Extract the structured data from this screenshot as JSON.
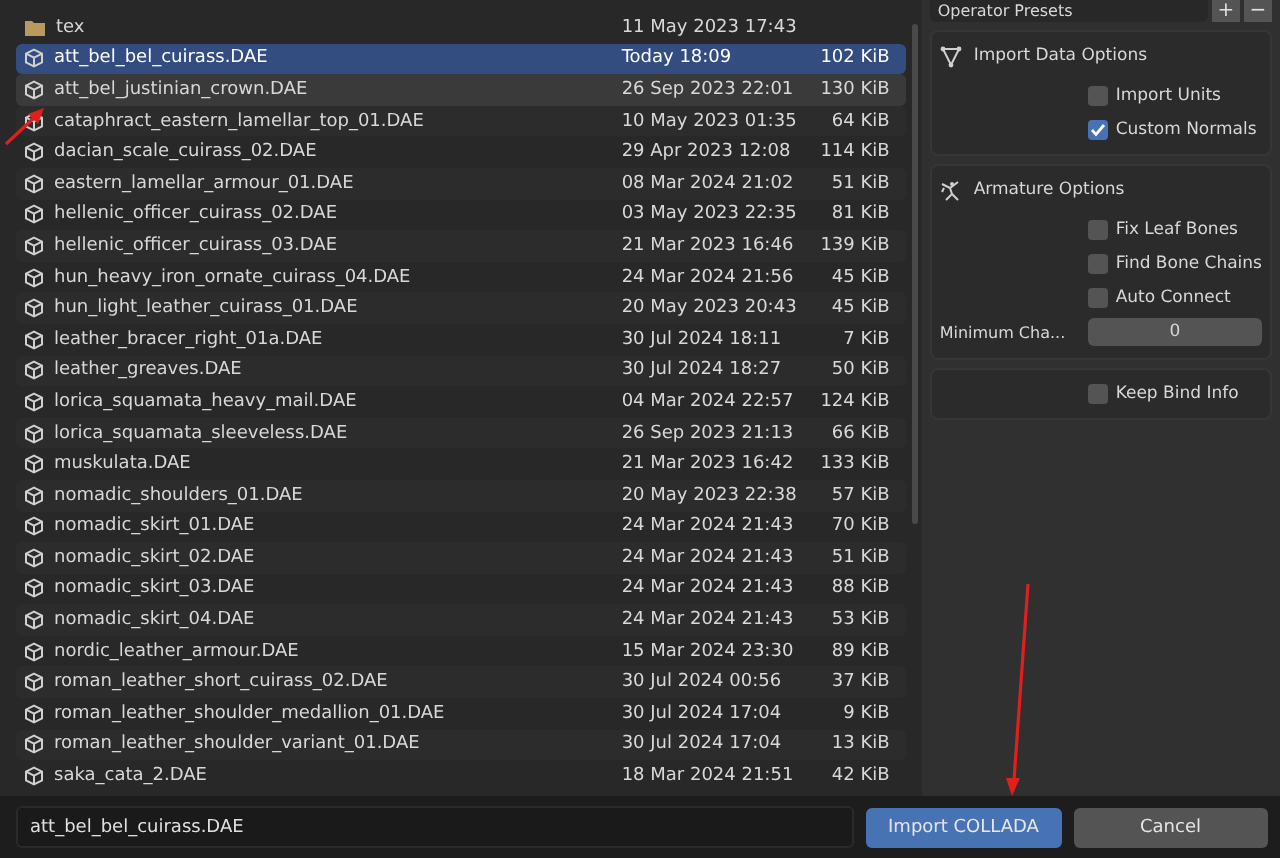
{
  "files": [
    {
      "kind": "folder",
      "name": "tex",
      "date": "11 May 2023 17:43",
      "selected": false,
      "highlighted": false
    },
    {
      "kind": "file",
      "name": "att_bel_bel_cuirass.DAE",
      "date": "Today 18:09",
      "size": "102 KiB",
      "selected": true,
      "highlighted": false
    },
    {
      "kind": "file",
      "name": "att_bel_justinian_crown.DAE",
      "date": "26 Sep 2023 22:01",
      "size": "130 KiB",
      "selected": false,
      "highlighted": true
    },
    {
      "kind": "file",
      "name": "cataphract_eastern_lamellar_top_01.DAE",
      "date": "10 May 2023 01:35",
      "size": "64 KiB",
      "selected": false,
      "highlighted": false
    },
    {
      "kind": "file",
      "name": "dacian_scale_cuirass_02.DAE",
      "date": "29 Apr 2023 12:08",
      "size": "114 KiB",
      "selected": false,
      "highlighted": false
    },
    {
      "kind": "file",
      "name": "eastern_lamellar_armour_01.DAE",
      "date": "08 Mar 2024 21:02",
      "size": "51 KiB",
      "selected": false,
      "highlighted": false
    },
    {
      "kind": "file",
      "name": "hellenic_officer_cuirass_02.DAE",
      "date": "03 May 2023 22:35",
      "size": "81 KiB",
      "selected": false,
      "highlighted": false
    },
    {
      "kind": "file",
      "name": "hellenic_officer_cuirass_03.DAE",
      "date": "21 Mar 2023 16:46",
      "size": "139 KiB",
      "selected": false,
      "highlighted": false
    },
    {
      "kind": "file",
      "name": "hun_heavy_iron_ornate_cuirass_04.DAE",
      "date": "24 Mar 2024 21:56",
      "size": "45 KiB",
      "selected": false,
      "highlighted": false
    },
    {
      "kind": "file",
      "name": "hun_light_leather_cuirass_01.DAE",
      "date": "20 May 2023 20:43",
      "size": "45 KiB",
      "selected": false,
      "highlighted": false
    },
    {
      "kind": "file",
      "name": "leather_bracer_right_01a.DAE",
      "date": "30 Jul 2024 18:11",
      "size": "7 KiB",
      "selected": false,
      "highlighted": false
    },
    {
      "kind": "file",
      "name": "leather_greaves.DAE",
      "date": "30 Jul 2024 18:27",
      "size": "50 KiB",
      "selected": false,
      "highlighted": false
    },
    {
      "kind": "file",
      "name": "lorica_squamata_heavy_mail.DAE",
      "date": "04 Mar 2024 22:57",
      "size": "124 KiB",
      "selected": false,
      "highlighted": false
    },
    {
      "kind": "file",
      "name": "lorica_squamata_sleeveless.DAE",
      "date": "26 Sep 2023 21:13",
      "size": "66 KiB",
      "selected": false,
      "highlighted": false
    },
    {
      "kind": "file",
      "name": "muskulata.DAE",
      "date": "21 Mar 2023 16:42",
      "size": "133 KiB",
      "selected": false,
      "highlighted": false
    },
    {
      "kind": "file",
      "name": "nomadic_shoulders_01.DAE",
      "date": "20 May 2023 22:38",
      "size": "57 KiB",
      "selected": false,
      "highlighted": false
    },
    {
      "kind": "file",
      "name": "nomadic_skirt_01.DAE",
      "date": "24 Mar 2024 21:43",
      "size": "70 KiB",
      "selected": false,
      "highlighted": false
    },
    {
      "kind": "file",
      "name": "nomadic_skirt_02.DAE",
      "date": "24 Mar 2024 21:43",
      "size": "51 KiB",
      "selected": false,
      "highlighted": false
    },
    {
      "kind": "file",
      "name": "nomadic_skirt_03.DAE",
      "date": "24 Mar 2024 21:43",
      "size": "88 KiB",
      "selected": false,
      "highlighted": false
    },
    {
      "kind": "file",
      "name": "nomadic_skirt_04.DAE",
      "date": "24 Mar 2024 21:43",
      "size": "53 KiB",
      "selected": false,
      "highlighted": false
    },
    {
      "kind": "file",
      "name": "nordic_leather_armour.DAE",
      "date": "15 Mar 2024 23:30",
      "size": "89 KiB",
      "selected": false,
      "highlighted": false
    },
    {
      "kind": "file",
      "name": "roman_leather_short_cuirass_02.DAE",
      "date": "30 Jul 2024 00:56",
      "size": "37 KiB",
      "selected": false,
      "highlighted": false
    },
    {
      "kind": "file",
      "name": "roman_leather_shoulder_medallion_01.DAE",
      "date": "30 Jul 2024 17:04",
      "size": "9 KiB",
      "selected": false,
      "highlighted": false
    },
    {
      "kind": "file",
      "name": "roman_leather_shoulder_variant_01.DAE",
      "date": "30 Jul 2024 17:04",
      "size": "13 KiB",
      "selected": false,
      "highlighted": false
    },
    {
      "kind": "file",
      "name": "saka_cata_2.DAE",
      "date": "18 Mar 2024 21:51",
      "size": "42 KiB",
      "selected": false,
      "highlighted": false
    }
  ],
  "presets": {
    "label": "Operator Presets",
    "add": "+",
    "remove": "−"
  },
  "panels": [
    {
      "title": "Import Data Options",
      "items": [
        {
          "kind": "checkbox",
          "label": "Import Units",
          "checked": false
        },
        {
          "kind": "checkbox",
          "label": "Custom Normals",
          "checked": true
        }
      ]
    },
    {
      "title": "Armature Options",
      "items": [
        {
          "kind": "checkbox",
          "label": "Fix Leaf Bones",
          "checked": false
        },
        {
          "kind": "checkbox",
          "label": "Find Bone Chains",
          "checked": false
        },
        {
          "kind": "checkbox",
          "label": "Auto Connect",
          "checked": false
        },
        {
          "kind": "number",
          "label": "Minimum Cha...",
          "value": "0"
        }
      ]
    },
    {
      "items": [
        {
          "kind": "checkbox",
          "label": "Keep Bind Info",
          "checked": false
        }
      ]
    }
  ],
  "filename": "att_bel_bel_cuirass.DAE",
  "buttons": [
    {
      "label": "Import COLLADA",
      "selected": true
    },
    {
      "label": "Cancel",
      "selected": false
    }
  ]
}
